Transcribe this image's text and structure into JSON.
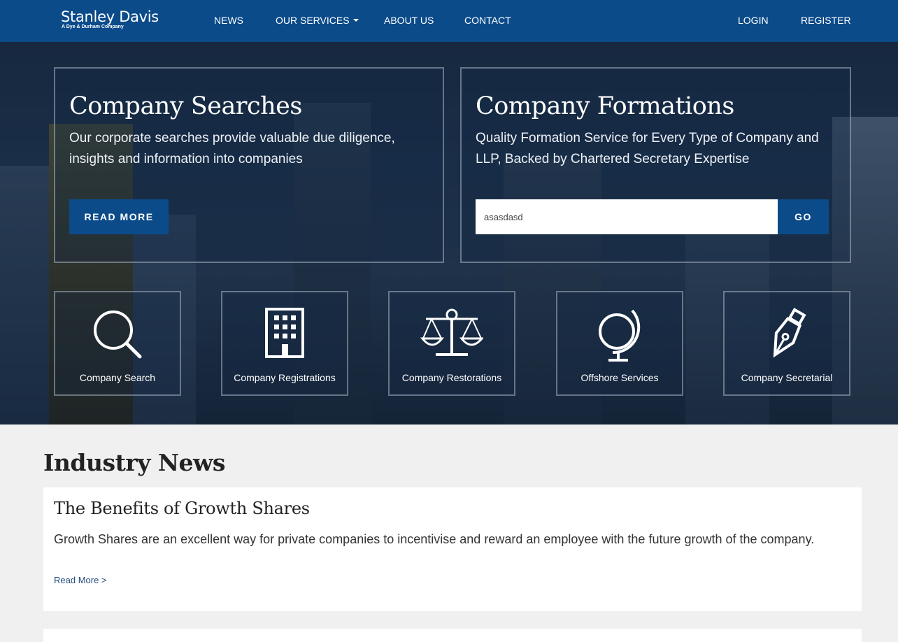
{
  "brand": {
    "name": "Stanley Davis",
    "tagline": "A Dye & Durham Company"
  },
  "nav": {
    "news": "NEWS",
    "services": "OUR SERVICES",
    "about": "ABOUT US",
    "contact": "CONTACT",
    "login": "LOGIN",
    "register": "REGISTER"
  },
  "searches": {
    "title": "Company Searches",
    "description": "Our corporate searches provide valuable due diligence, insights and information into companies",
    "button": "READ MORE"
  },
  "formations": {
    "title": "Company Formations",
    "description": "Quality Formation Service for Every Type of Company and LLP, Backed by Chartered Secretary Expertise",
    "input_value": "asasdasd",
    "button": "GO"
  },
  "tiles": [
    {
      "label": "Company Search",
      "icon": "magnifier-icon"
    },
    {
      "label": "Company Registrations",
      "icon": "building-icon"
    },
    {
      "label": "Company Restorations",
      "icon": "scales-icon"
    },
    {
      "label": "Offshore Services",
      "icon": "globe-icon"
    },
    {
      "label": "Company Secretarial",
      "icon": "fountain-pen-icon"
    }
  ],
  "news": {
    "heading": "Industry News",
    "articles": [
      {
        "title": "The Benefits of Growth Shares",
        "summary": "Growth Shares are an excellent way for private companies to incentivise and reward an employee with the future growth of the company.",
        "link": "Read More >"
      }
    ]
  },
  "colors": {
    "brand_blue": "#0b4b8a",
    "page_bg": "#f0f0f0"
  }
}
